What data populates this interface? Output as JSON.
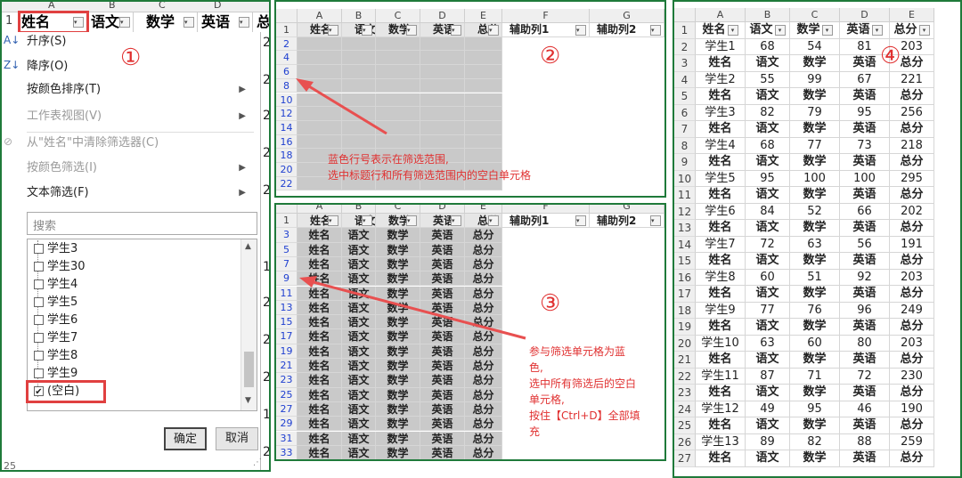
{
  "panel1": {
    "marker": "①",
    "col_headers": [
      "A",
      "B",
      "C",
      "D"
    ],
    "row1_num": "1",
    "header_cells": [
      "姓名",
      "语文",
      "数学",
      "英语",
      "总"
    ],
    "menu_items": [
      {
        "label": "升序(S)",
        "disabled": false,
        "icon": "sort-asc-icon"
      },
      {
        "label": "降序(O)",
        "disabled": false,
        "icon": "sort-desc-icon"
      },
      {
        "label": "按颜色排序(T)",
        "disabled": false,
        "submenu": true
      },
      {
        "label": "工作表视图(V)",
        "disabled": true,
        "submenu": true
      },
      {
        "label": "从\"姓名\"中清除筛选器(C)",
        "disabled": true,
        "icon": "clear-filter-icon"
      },
      {
        "label": "按颜色筛选(I)",
        "disabled": true,
        "submenu": true
      },
      {
        "label": "文本筛选(F)",
        "disabled": false,
        "submenu": true
      }
    ],
    "search_placeholder": "搜索",
    "list_items": [
      {
        "label": "学生3",
        "checked": false
      },
      {
        "label": "学生30",
        "checked": false
      },
      {
        "label": "学生4",
        "checked": false
      },
      {
        "label": "学生5",
        "checked": false
      },
      {
        "label": "学生6",
        "checked": false
      },
      {
        "label": "学生7",
        "checked": false
      },
      {
        "label": "学生8",
        "checked": false
      },
      {
        "label": "学生9",
        "checked": false
      },
      {
        "label": "(空白)",
        "checked": true
      }
    ],
    "ok_label": "确定",
    "cancel_label": "取消",
    "right_col_values": [
      "2",
      "2",
      "2",
      "2",
      "2",
      "1",
      "2",
      "2",
      "2",
      "1",
      "2"
    ],
    "bottom_row": "25"
  },
  "panel2": {
    "marker": "②",
    "col_headers": [
      "A",
      "B",
      "C",
      "D",
      "E",
      "F",
      "G"
    ],
    "header_cells": [
      "姓名",
      "语文",
      "数学",
      "英语",
      "总分",
      "辅助列1",
      "辅助列2"
    ],
    "row_numbers": [
      "1",
      "2",
      "4",
      "6",
      "8",
      "10",
      "12",
      "14",
      "16",
      "18",
      "20",
      "22"
    ],
    "annotation": [
      "蓝色行号表示在筛选范围,",
      "选中标题行和所有筛选范围内的空白单元格"
    ]
  },
  "panel3": {
    "marker": "③",
    "col_headers": [
      "A",
      "B",
      "C",
      "D",
      "E",
      "F",
      "G"
    ],
    "header_cells": [
      "姓名",
      "语文",
      "数学",
      "英语",
      "总分",
      "辅助列1",
      "辅助列2"
    ],
    "row_numbers": [
      "1",
      "3",
      "5",
      "7",
      "9",
      "11",
      "13",
      "15",
      "17",
      "19",
      "21",
      "23",
      "25",
      "27",
      "29",
      "31",
      "33"
    ],
    "data_cells": [
      "姓名",
      "语文",
      "数学",
      "英语",
      "总分"
    ],
    "annotation": [
      "参与筛选单元格为蓝",
      "色,",
      "选中所有筛选后的空白",
      "单元格,",
      "按住【Ctrl+D】全部填",
      "充"
    ]
  },
  "panel4": {
    "marker": "④",
    "col_headers": [
      "A",
      "B",
      "C",
      "D",
      "E"
    ],
    "rows": [
      {
        "n": "1",
        "cells": [
          "姓名",
          "语文",
          "数学",
          "英语",
          "总分"
        ],
        "hdr": true,
        "dd": true
      },
      {
        "n": "2",
        "cells": [
          "学生1",
          "68",
          "54",
          "81",
          "203"
        ]
      },
      {
        "n": "3",
        "cells": [
          "姓名",
          "语文",
          "数学",
          "英语",
          "总分"
        ],
        "hdr": true
      },
      {
        "n": "4",
        "cells": [
          "学生2",
          "55",
          "99",
          "67",
          "221"
        ]
      },
      {
        "n": "5",
        "cells": [
          "姓名",
          "语文",
          "数学",
          "英语",
          "总分"
        ],
        "hdr": true
      },
      {
        "n": "6",
        "cells": [
          "学生3",
          "82",
          "79",
          "95",
          "256"
        ]
      },
      {
        "n": "7",
        "cells": [
          "姓名",
          "语文",
          "数学",
          "英语",
          "总分"
        ],
        "hdr": true
      },
      {
        "n": "8",
        "cells": [
          "学生4",
          "68",
          "77",
          "73",
          "218"
        ]
      },
      {
        "n": "9",
        "cells": [
          "姓名",
          "语文",
          "数学",
          "英语",
          "总分"
        ],
        "hdr": true
      },
      {
        "n": "10",
        "cells": [
          "学生5",
          "95",
          "100",
          "100",
          "295"
        ]
      },
      {
        "n": "11",
        "cells": [
          "姓名",
          "语文",
          "数学",
          "英语",
          "总分"
        ],
        "hdr": true
      },
      {
        "n": "12",
        "cells": [
          "学生6",
          "84",
          "52",
          "66",
          "202"
        ]
      },
      {
        "n": "13",
        "cells": [
          "姓名",
          "语文",
          "数学",
          "英语",
          "总分"
        ],
        "hdr": true
      },
      {
        "n": "14",
        "cells": [
          "学生7",
          "72",
          "63",
          "56",
          "191"
        ]
      },
      {
        "n": "15",
        "cells": [
          "姓名",
          "语文",
          "数学",
          "英语",
          "总分"
        ],
        "hdr": true
      },
      {
        "n": "16",
        "cells": [
          "学生8",
          "60",
          "51",
          "92",
          "203"
        ]
      },
      {
        "n": "17",
        "cells": [
          "姓名",
          "语文",
          "数学",
          "英语",
          "总分"
        ],
        "hdr": true
      },
      {
        "n": "18",
        "cells": [
          "学生9",
          "77",
          "76",
          "96",
          "249"
        ]
      },
      {
        "n": "19",
        "cells": [
          "姓名",
          "语文",
          "数学",
          "英语",
          "总分"
        ],
        "hdr": true
      },
      {
        "n": "20",
        "cells": [
          "学生10",
          "63",
          "60",
          "80",
          "203"
        ]
      },
      {
        "n": "21",
        "cells": [
          "姓名",
          "语文",
          "数学",
          "英语",
          "总分"
        ],
        "hdr": true
      },
      {
        "n": "22",
        "cells": [
          "学生11",
          "87",
          "71",
          "72",
          "230"
        ]
      },
      {
        "n": "23",
        "cells": [
          "姓名",
          "语文",
          "数学",
          "英语",
          "总分"
        ],
        "hdr": true
      },
      {
        "n": "24",
        "cells": [
          "学生12",
          "49",
          "95",
          "46",
          "190"
        ]
      },
      {
        "n": "25",
        "cells": [
          "姓名",
          "语文",
          "数学",
          "英语",
          "总分"
        ],
        "hdr": true
      },
      {
        "n": "26",
        "cells": [
          "学生13",
          "89",
          "82",
          "88",
          "259"
        ]
      },
      {
        "n": "27",
        "cells": [
          "姓名",
          "语文",
          "数学",
          "英语",
          "总分"
        ],
        "hdr": true
      }
    ]
  },
  "colors": {
    "panel_border": "#1f7a3a",
    "annotation": "#e03030",
    "highlight_box": "#e04040",
    "filter_row_num": "#2040d0",
    "gray_cell": "#c9c9c9"
  }
}
